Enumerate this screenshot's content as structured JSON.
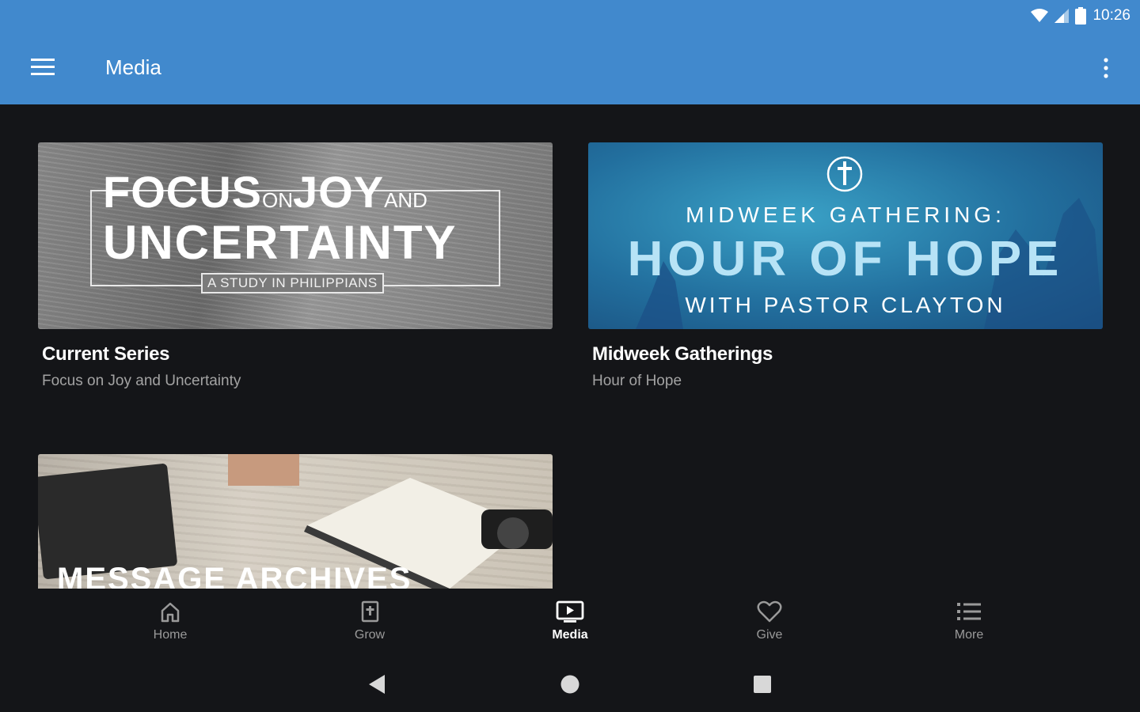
{
  "status_bar": {
    "time": "10:26",
    "icons": [
      "wifi-icon",
      "signal-icon",
      "battery-icon"
    ]
  },
  "app_bar": {
    "title": "Media",
    "menu_icon": "hamburger-menu-icon",
    "overflow_icon": "more-vert-icon"
  },
  "colors": {
    "app_bar": "#4189cd",
    "background": "#141518",
    "subtitle": "#a3a3a3",
    "nav_inactive": "#9a9a9a",
    "nav_active": "#ffffff"
  },
  "cards": [
    {
      "title": "Current Series",
      "subtitle": "Focus on Joy and Uncertainty",
      "thumb": {
        "word1": "FOCUS",
        "word2": "ON",
        "word3": "JOY",
        "word4": "AND",
        "line2": "UNCERTAINTY",
        "sub": "A STUDY IN PHILIPPIANS"
      }
    },
    {
      "title": "Midweek Gatherings",
      "subtitle": "Hour of Hope",
      "thumb": {
        "line1": "MIDWEEK GATHERING:",
        "line2": "HOUR OF HOPE",
        "line3": "WITH PASTOR CLAYTON"
      }
    },
    {
      "thumb": {
        "line1": "MESSAGE ARCHIVES"
      }
    }
  ],
  "bottom_nav": [
    {
      "label": "Home",
      "icon": "home-icon",
      "active": false
    },
    {
      "label": "Grow",
      "icon": "bible-icon",
      "active": false
    },
    {
      "label": "Media",
      "icon": "tv-play-icon",
      "active": true
    },
    {
      "label": "Give",
      "icon": "heart-icon",
      "active": false
    },
    {
      "label": "More",
      "icon": "list-icon",
      "active": false
    }
  ],
  "system_nav": [
    "back-icon",
    "home-circle-icon",
    "recents-icon"
  ]
}
